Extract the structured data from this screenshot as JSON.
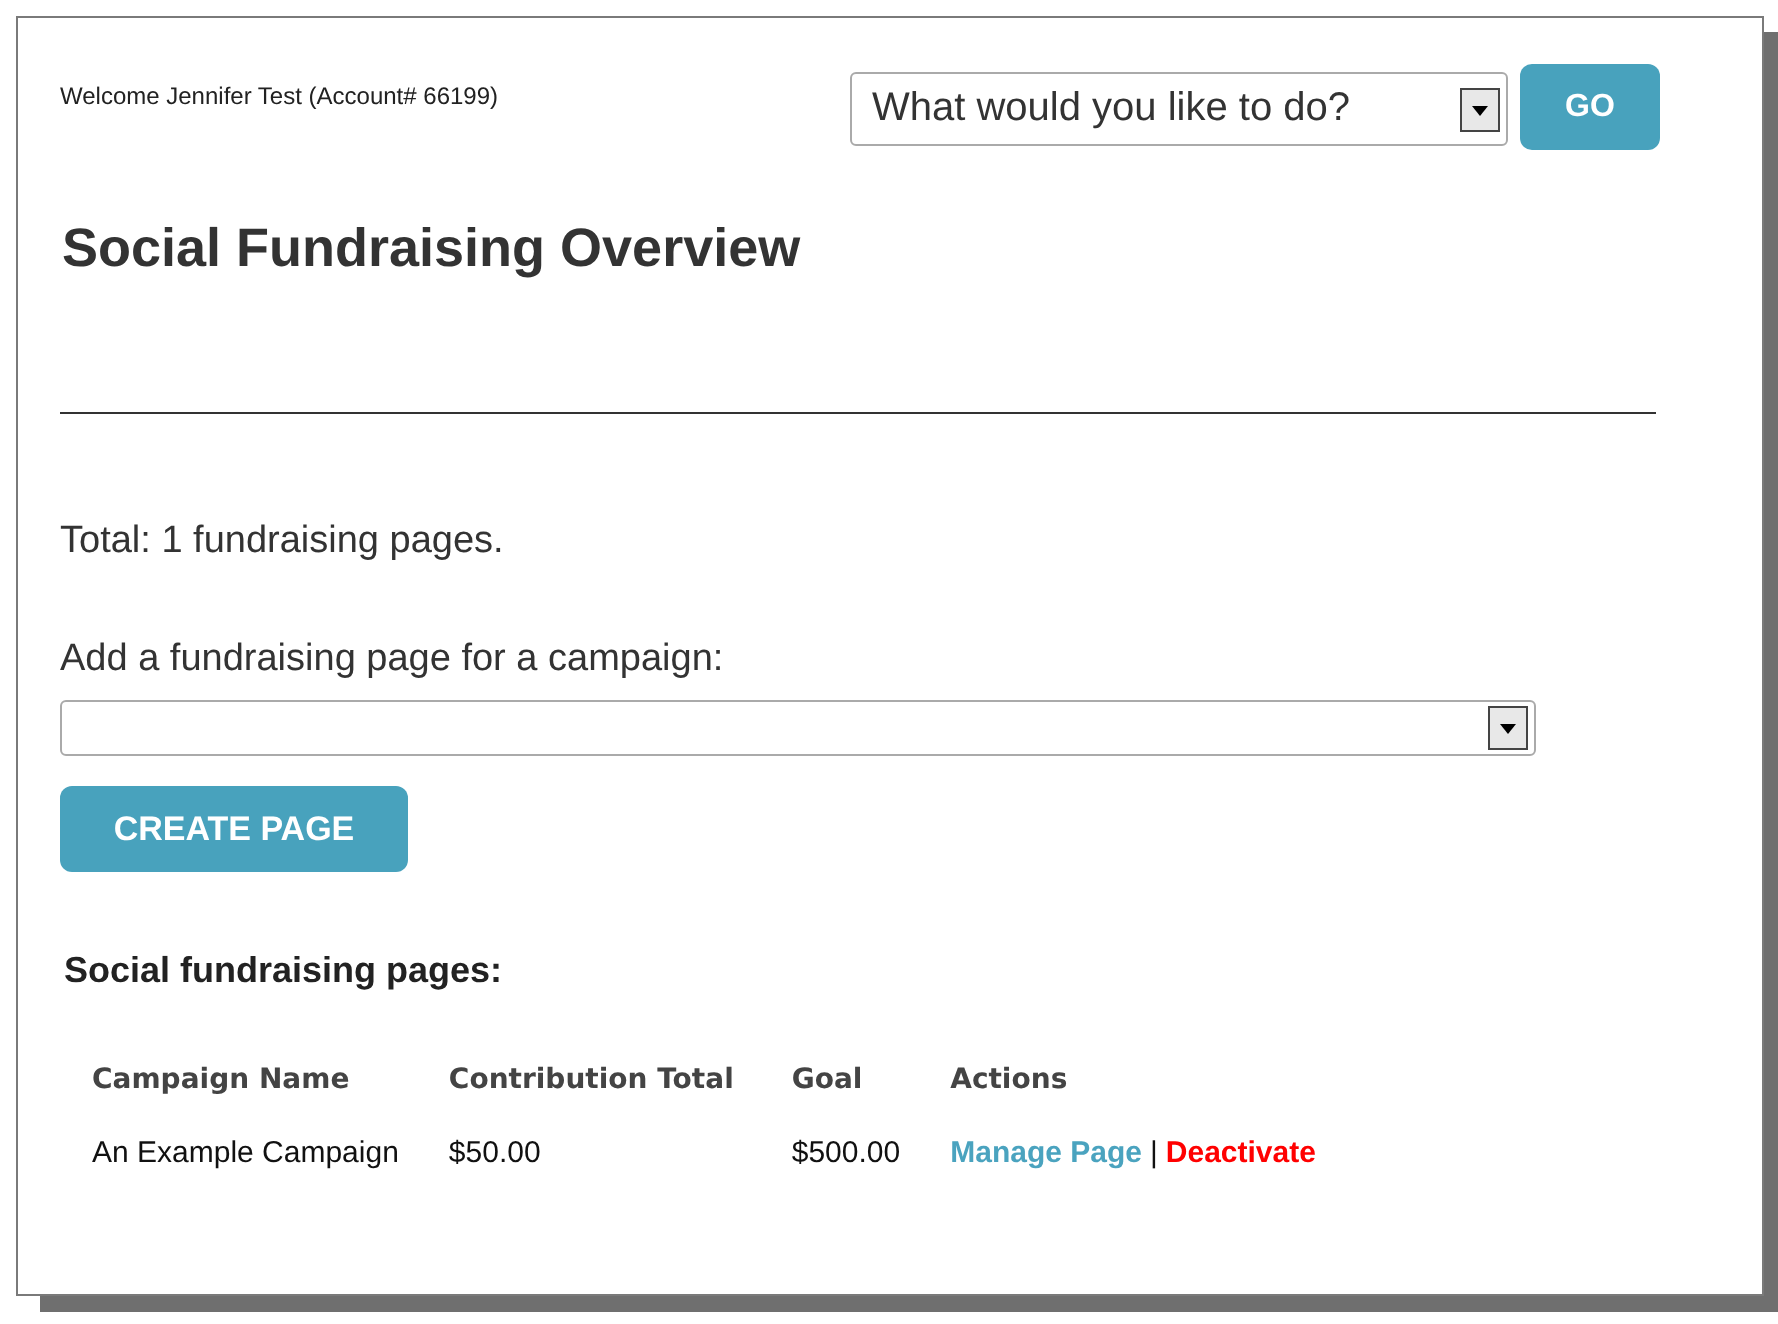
{
  "welcome": "Welcome Jennifer Test (Account# 66199)",
  "action_select": {
    "value": "What would you like to do?"
  },
  "go_button": "GO",
  "title": "Social Fundraising Overview",
  "total": "Total: 1 fundraising pages.",
  "add_label": "Add a fundraising page for a campaign:",
  "create_button": "CREATE PAGE",
  "section_title": "Social fundraising pages:",
  "table": {
    "columns": [
      "Campaign Name",
      "Contribution Total",
      "Goal",
      "Actions"
    ],
    "rows": [
      {
        "cells": [
          "An Example Campaign",
          "$50.00",
          "$500.00"
        ],
        "actions": [
          {
            "label": "Manage Page",
            "color": "#4aa3bf"
          },
          {
            "label": "Deactivate",
            "color": "#ff0000"
          }
        ],
        "separator": "|"
      }
    ]
  }
}
